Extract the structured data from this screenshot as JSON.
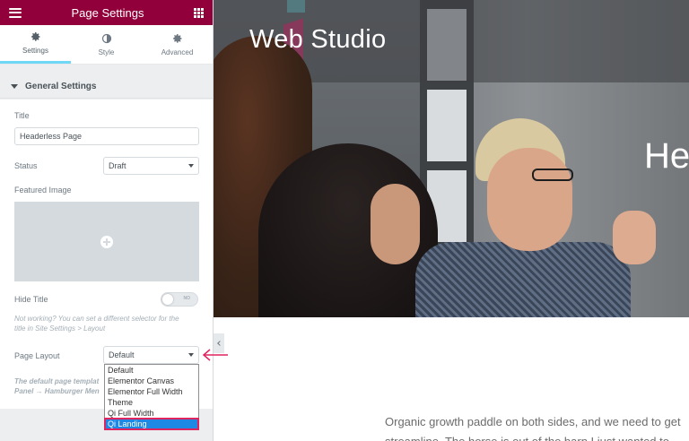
{
  "panel": {
    "header_title": "Page Settings",
    "tabs": [
      {
        "label": "Settings",
        "icon": "gear-icon"
      },
      {
        "label": "Style",
        "icon": "half-circle-icon"
      },
      {
        "label": "Advanced",
        "icon": "gear-icon"
      }
    ],
    "section_title": "General Settings",
    "title_label": "Title",
    "title_value": "Headerless Page",
    "status_label": "Status",
    "status_value": "Draft",
    "featured_image_label": "Featured Image",
    "hide_title_label": "Hide Title",
    "toggle_text": "NO",
    "note_line1": "Not working? You can set a different selector for the",
    "note_line2": "title in Site Settings > Layout",
    "page_layout_label": "Page Layout",
    "page_layout_value": "Default",
    "layout_note_line1": "The default page templat",
    "layout_note_line2": "Panel → Hamburger Men",
    "layout_options": [
      "Default",
      "Elementor Canvas",
      "Elementor Full Width",
      "Theme",
      "Qi Full Width",
      "Qi Landing"
    ],
    "layout_selected": "Qi Landing"
  },
  "preview": {
    "site_title": "Web Studio",
    "hero_heading": "He",
    "body_line1": "Organic growth paddle on both sides, and we need to get",
    "body_line2": "streamline. The horse is out of the barn I just wanted to"
  },
  "colors": {
    "header": "#92003b",
    "tab_active": "#71d7f7",
    "highlight": "#e0245e",
    "selected_option": "#1e88e5"
  }
}
